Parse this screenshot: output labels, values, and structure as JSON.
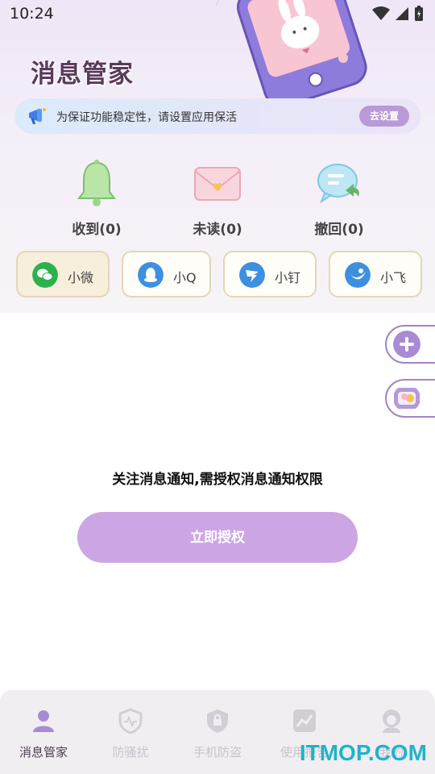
{
  "status_bar": {
    "time": "10:24"
  },
  "header": {
    "title": "消息管家"
  },
  "tip_banner": {
    "text": "为保证功能稳定性，请设置应用保活",
    "button_label": "去设置"
  },
  "stats": [
    {
      "icon": "bell-icon",
      "label": "收到(0)"
    },
    {
      "icon": "envelope-icon",
      "label": "未读(0)"
    },
    {
      "icon": "recall-bubble-icon",
      "label": "撤回(0)"
    }
  ],
  "app_tabs": [
    {
      "icon": "wechat-icon",
      "label": "小微",
      "color": "#2bb24c",
      "active": true
    },
    {
      "icon": "qq-icon",
      "label": "小Q",
      "color": "#3d8fe0",
      "active": false
    },
    {
      "icon": "dingtalk-icon",
      "label": "小钉",
      "color": "#3d8fe0",
      "active": false
    },
    {
      "icon": "feishu-icon",
      "label": "小飞",
      "color": "#3d8fe0",
      "active": false
    }
  ],
  "main": {
    "notice": "关注消息通知,需授权消息通知权限",
    "auth_button_label": "立即授权"
  },
  "bottom_nav": [
    {
      "icon": "person-icon",
      "label": "消息管家",
      "active": true
    },
    {
      "icon": "shield-pulse-icon",
      "label": "防骚扰",
      "active": false
    },
    {
      "icon": "shield-lock-icon",
      "label": "手机防盗",
      "active": false
    },
    {
      "icon": "chart-icon",
      "label": "使用报告",
      "active": false
    },
    {
      "icon": "avatar-icon",
      "label": "我的",
      "active": false
    }
  ],
  "watermark": "ITMOP.COM",
  "colors": {
    "accent": "#cca6e4",
    "title": "#5a3a5c",
    "tab_border": "#e5d6b5"
  }
}
